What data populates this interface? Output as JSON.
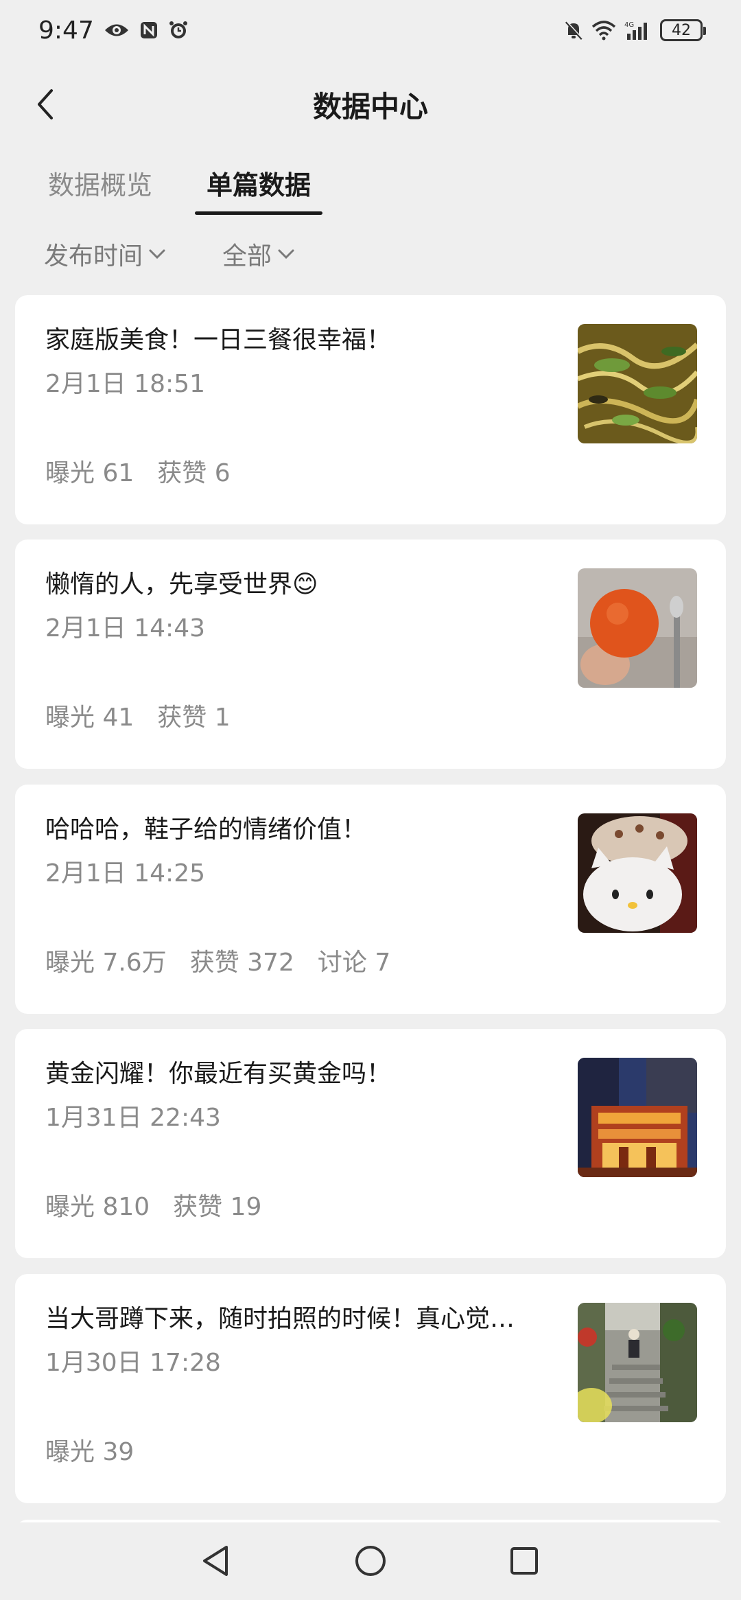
{
  "status_bar": {
    "time": "9:47",
    "battery": "42",
    "icons": [
      "eye-icon",
      "nfc-icon",
      "alarm-icon",
      "mute-icon",
      "wifi-icon",
      "signal-4g-icon",
      "battery-icon"
    ]
  },
  "header": {
    "title": "数据中心",
    "back_icon": "chevron-left-icon"
  },
  "tabs": [
    {
      "label": "数据概览",
      "active": false
    },
    {
      "label": "单篇数据",
      "active": true
    }
  ],
  "filters": [
    {
      "label": "发布时间",
      "icon": "chevron-down-icon"
    },
    {
      "label": "全部",
      "icon": "chevron-down-icon"
    }
  ],
  "posts": [
    {
      "title": "家庭版美食！一日三餐很幸福！",
      "date": "2月1日 18:51",
      "stats": [
        "曝光 61",
        "获赞 6"
      ],
      "thumbnail": "fried-noodles-photo"
    },
    {
      "title": "懒惰的人，先享受世界😊",
      "date": "2月1日 14:43",
      "stats": [
        "曝光 41",
        "获赞 1"
      ],
      "thumbnail": "orange-fruit-photo"
    },
    {
      "title": "哈哈哈，鞋子给的情绪价值！",
      "date": "2月1日 14:25",
      "stats": [
        "曝光 7.6万",
        "获赞 372",
        "讨论 7"
      ],
      "thumbnail": "hello-kitty-slipper-photo"
    },
    {
      "title": "黄金闪耀！你最近有买黄金吗！",
      "date": "1月31日 22:43",
      "stats": [
        "曝光 810",
        "获赞 19"
      ],
      "thumbnail": "golden-building-night-photo"
    },
    {
      "title": "当大哥蹲下来，随时拍照的时候！真心觉…",
      "date": "1月30日 17:28",
      "stats": [
        "曝光 39"
      ],
      "thumbnail": "alley-stairs-photo"
    }
  ],
  "nav_bar": {
    "icons": [
      "nav-back-icon",
      "nav-home-icon",
      "nav-recent-icon"
    ]
  },
  "colors": {
    "background": "#efefef",
    "card": "#ffffff",
    "text_primary": "#1a1a1a",
    "text_secondary": "#8a8a8a"
  }
}
